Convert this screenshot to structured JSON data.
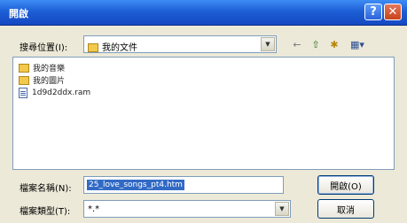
{
  "window": {
    "title": "開啟",
    "help_glyph": "?",
    "close_glyph": "✕"
  },
  "lookin": {
    "label": "搜尋位置(I):",
    "value": "我的文件"
  },
  "toolbar": {
    "back_glyph": "←",
    "up_glyph": "⇧",
    "new_folder_glyph": "✱",
    "views_glyph": "▦▾"
  },
  "files": [
    {
      "name": "我的音樂",
      "type": "folder"
    },
    {
      "name": "我的圖片",
      "type": "folder"
    },
    {
      "name": "1d9d2ddx.ram",
      "type": "file"
    }
  ],
  "filename": {
    "label": "檔案名稱(N):",
    "value": "25_love_songs_pt4.htm"
  },
  "filetype": {
    "label": "檔案類型(T):",
    "value": "*.*"
  },
  "buttons": {
    "open": "開啟(O)",
    "cancel": "取消"
  },
  "colors": {
    "titlebar": "#1d5fd6",
    "selection": "#316ac5",
    "dialog_bg": "#ece9d8"
  }
}
